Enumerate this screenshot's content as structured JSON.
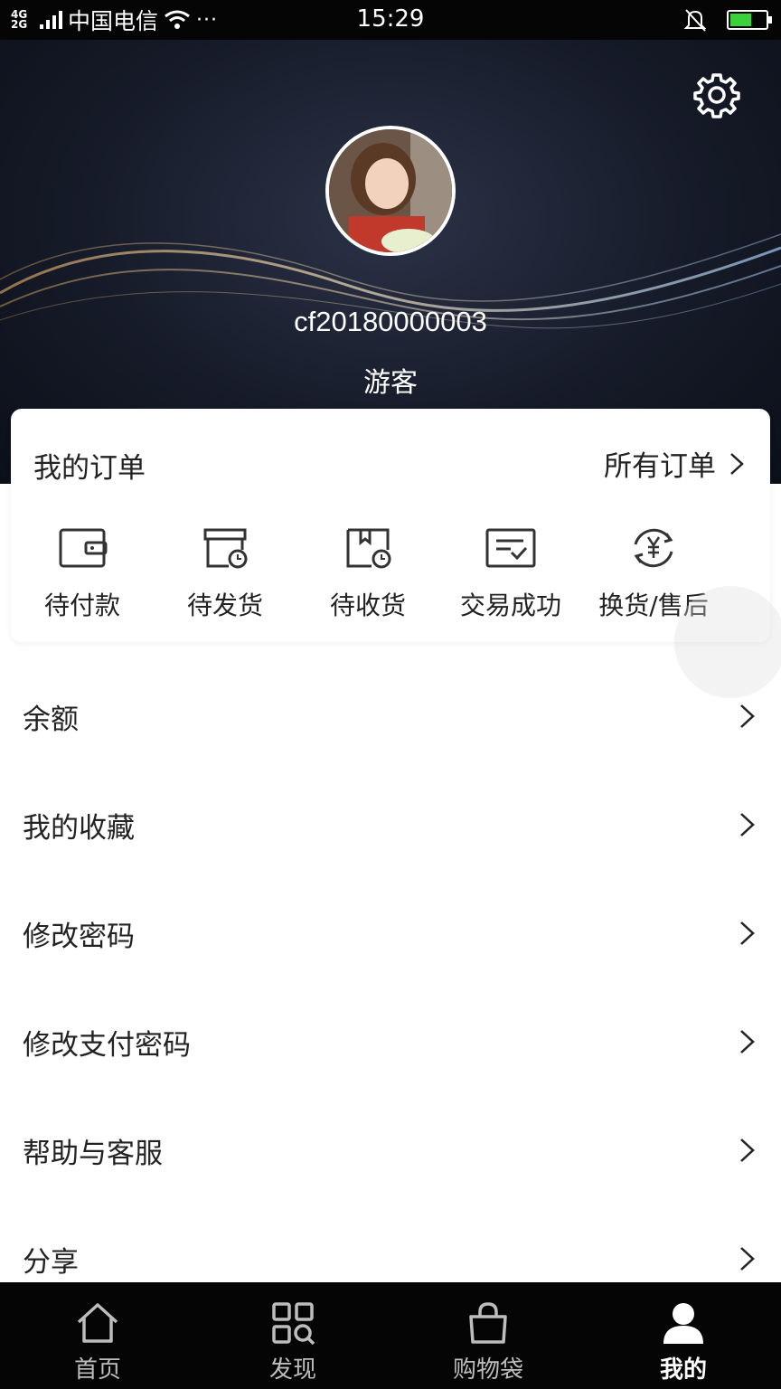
{
  "status_bar": {
    "network": "4G\n2G",
    "carrier": "中国电信",
    "more": "···",
    "time": "15:29"
  },
  "header": {
    "username": "cf20180000003",
    "role": "游客"
  },
  "orders": {
    "title": "我的订单",
    "all_orders": "所有订单",
    "items": [
      {
        "label": "待付款",
        "icon": "wallet-icon"
      },
      {
        "label": "待发货",
        "icon": "box-clock-icon"
      },
      {
        "label": "待收货",
        "icon": "package-clock-icon"
      },
      {
        "label": "交易成功",
        "icon": "doc-check-icon"
      },
      {
        "label": "换货/售后",
        "icon": "yen-refresh-icon"
      }
    ]
  },
  "menu": {
    "items": [
      {
        "label": "余额"
      },
      {
        "label": "我的收藏"
      },
      {
        "label": "修改密码"
      },
      {
        "label": "修改支付密码"
      },
      {
        "label": "帮助与客服"
      },
      {
        "label": "分享"
      }
    ]
  },
  "tabbar": {
    "tabs": [
      {
        "label": "首页",
        "icon": "home-icon"
      },
      {
        "label": "发现",
        "icon": "discover-icon"
      },
      {
        "label": "购物袋",
        "icon": "bag-icon"
      },
      {
        "label": "我的",
        "icon": "user-icon"
      }
    ],
    "active_index": 3
  },
  "colors": {
    "tabbar_bg": "#050505",
    "battery": "#3ad13a",
    "header_bg": "#161b29"
  }
}
